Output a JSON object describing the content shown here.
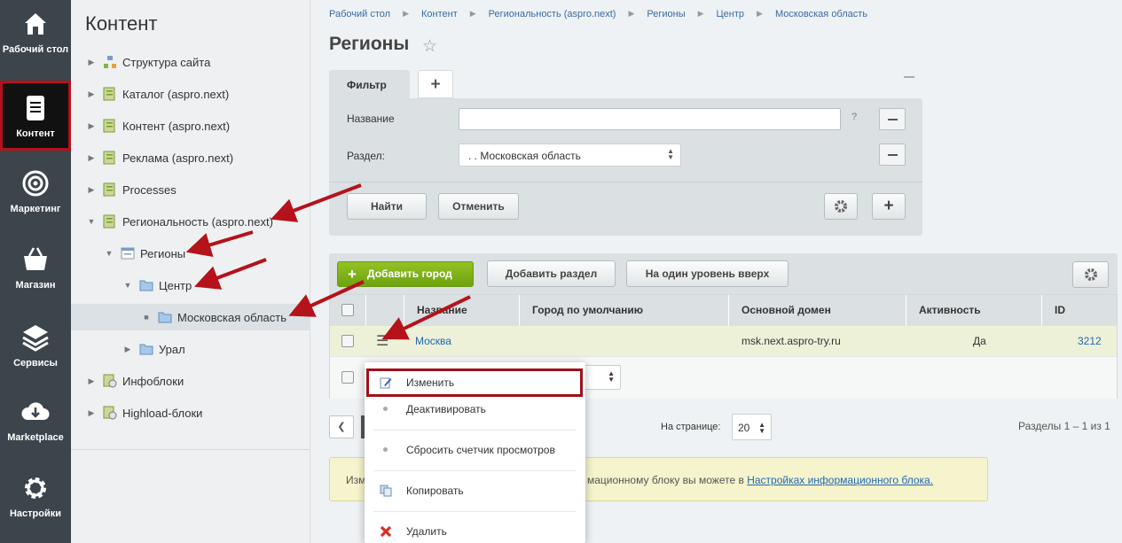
{
  "sidebar": {
    "items": [
      {
        "label": "Рабочий стол",
        "icon": "home-icon"
      },
      {
        "label": "Контент",
        "icon": "document-icon"
      },
      {
        "label": "Маркетинг",
        "icon": "target-icon"
      },
      {
        "label": "Магазин",
        "icon": "basket-icon"
      },
      {
        "label": "Сервисы",
        "icon": "layers-icon"
      },
      {
        "label": "Marketplace",
        "icon": "cloud-download-icon"
      },
      {
        "label": "Настройки",
        "icon": "gear-icon"
      }
    ],
    "active": "Контент"
  },
  "tree": {
    "title": "Контент",
    "items": [
      {
        "label": "Структура сайта"
      },
      {
        "label": "Каталог (aspro.next)"
      },
      {
        "label": "Контент (aspro.next)"
      },
      {
        "label": "Реклама (aspro.next)"
      },
      {
        "label": "Processes"
      },
      {
        "label": "Региональность (aspro.next)"
      },
      {
        "label": "Регионы"
      },
      {
        "label": "Центр"
      },
      {
        "label": "Московская область"
      },
      {
        "label": "Урал"
      },
      {
        "label": "Инфоблоки"
      },
      {
        "label": "Highload-блоки"
      }
    ]
  },
  "breadcrumb": [
    "Рабочий стол",
    "Контент",
    "Региональность (aspro.next)",
    "Регионы",
    "Центр",
    "Московская область"
  ],
  "page": {
    "title": "Регионы"
  },
  "filter": {
    "tab_label": "Фильтр",
    "add_tab": "+",
    "name_label": "Название",
    "name_value": "",
    "help": "?",
    "section_label": "Раздел:",
    "section_value": ". . Московская область",
    "find_button": "Найти",
    "cancel_button": "Отменить",
    "add_button": "+"
  },
  "toolbar": {
    "add_city": "Добавить город",
    "add_section": "Добавить раздел",
    "level_up": "На один уровень вверх"
  },
  "table": {
    "columns": [
      "Название",
      "Город по умолчанию",
      "Основной домен",
      "Активность",
      "ID"
    ],
    "rows": [
      {
        "name": "Москва",
        "default_city": "",
        "domain": "msk.next.aspro-try.ru",
        "active": "Да",
        "id": "3212"
      }
    ]
  },
  "pager": {
    "per_page_label": "На странице:",
    "per_page_value": "20",
    "sections_count": "Разделы 1 – 1 из 1"
  },
  "info": {
    "left_text": "Изм",
    "right_text": "мационному блоку вы можете в ",
    "link_text": "Настройках информационного блока."
  },
  "context_menu": {
    "items": [
      {
        "label": "Изменить"
      },
      {
        "label": "Деактивировать"
      },
      {
        "label": "Сбросить счетчик просмотров"
      },
      {
        "label": "Копировать"
      },
      {
        "label": "Удалить"
      }
    ]
  },
  "colors": {
    "sidebar_bg": "#3c454c",
    "accent_green": "#7bb11a",
    "highlight_red": "#a20f1a",
    "link_blue": "#2067b0"
  }
}
